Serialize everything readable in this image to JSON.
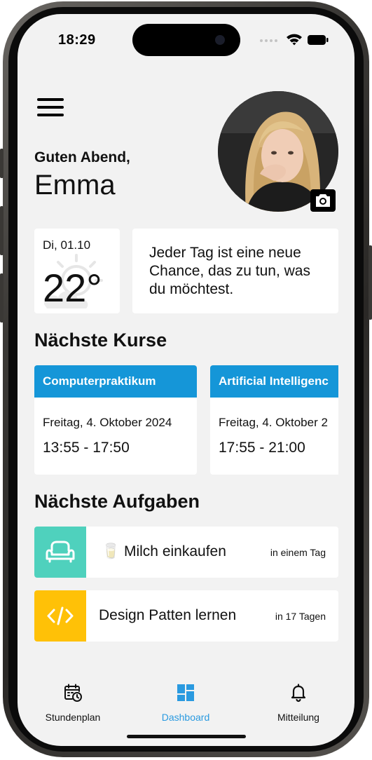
{
  "status_bar": {
    "time": "18:29"
  },
  "header": {
    "greeting": "Guten Abend,",
    "user_name": "Emma"
  },
  "weather": {
    "date": "Di, 01.10",
    "temperature": "22°"
  },
  "quote": {
    "line1": "Jeder Tag ist eine neue",
    "line2": "Chance, das zu tun, was",
    "line3": "du möchtest."
  },
  "courses": {
    "title": "Nächste Kurse",
    "items": [
      {
        "name": "Computerpraktikum",
        "date": "Freitag, 4. Oktober 2024",
        "time": "13:55 - 17:50"
      },
      {
        "name": "Artificial Intelligenc",
        "date": "Freitag, 4. Oktober 2",
        "time": "17:55 - 21:00"
      }
    ]
  },
  "tasks": {
    "title": "Nächste Aufgaben",
    "items": [
      {
        "title": "🥛 Milch einkaufen",
        "due": "in einem Tag",
        "icon": "armchair-icon",
        "color": "#4fd1bd"
      },
      {
        "title": "Design Patten lernen",
        "due": "in 17 Tagen",
        "icon": "code-icon",
        "color": "#ffc107"
      }
    ]
  },
  "tabbar": {
    "items": [
      {
        "label": "Stundenplan",
        "icon": "calendar-clock-icon"
      },
      {
        "label": "Dashboard",
        "icon": "dashboard-grid-icon",
        "active": true
      },
      {
        "label": "Mitteilung",
        "icon": "bell-icon"
      }
    ],
    "active_color": "#2a9ae0"
  },
  "colors": {
    "background": "#f2f2f2",
    "course_header": "#1596d8"
  }
}
